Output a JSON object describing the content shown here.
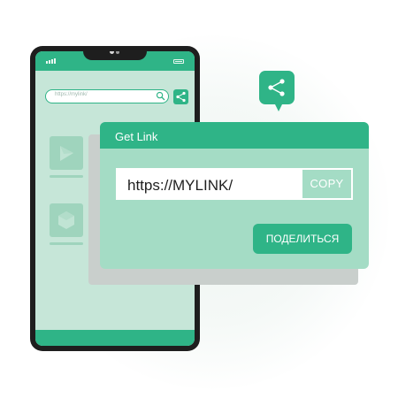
{
  "colors": {
    "accent": "#2fb487",
    "dialog_body": "#a4dcc5",
    "screen": "#c6e6d8",
    "phone_frame": "#1e1e1e"
  },
  "phone": {
    "search": {
      "text": "https://mylink/",
      "icon": "search-icon"
    },
    "share_icon": "share-icon",
    "thumbnails": [
      {
        "icon": "triangle-shape"
      },
      {
        "icon": "hexagon-shape"
      }
    ]
  },
  "share_badge": {
    "icon": "share-icon"
  },
  "dialog": {
    "title": "Get Link",
    "url": "https://MYLINK/",
    "copy_label": "COPY",
    "share_label": "ПОДЕЛИТЬСЯ"
  }
}
